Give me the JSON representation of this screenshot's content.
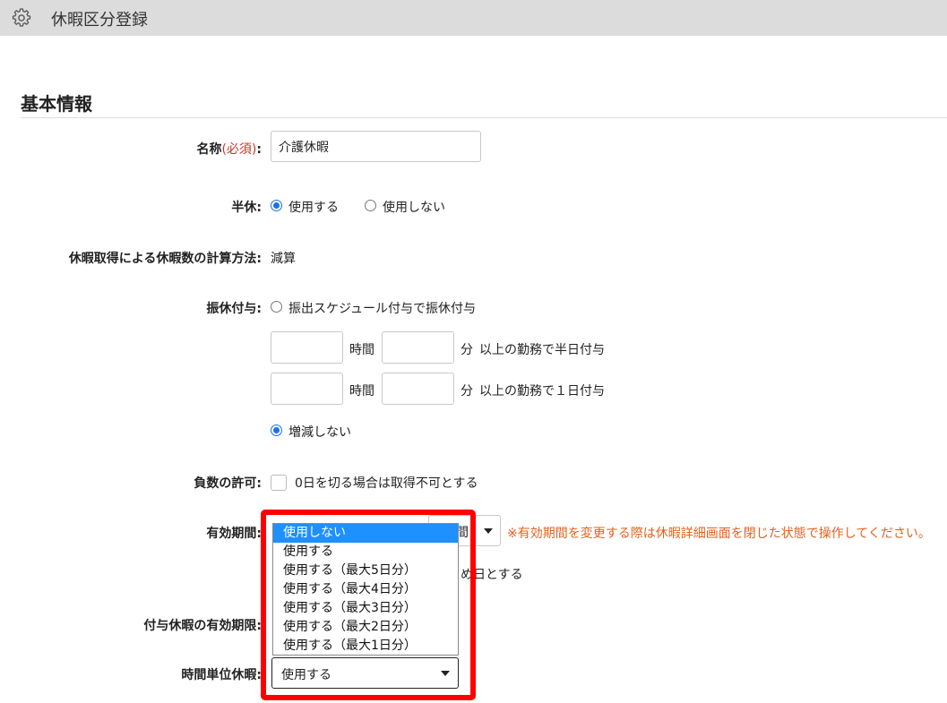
{
  "header": {
    "title": "休暇区分登録",
    "icon": "gear-icon"
  },
  "section": {
    "title": "基本情報"
  },
  "form": {
    "name": {
      "label": "名称",
      "required": "(必須)",
      "colon": ":",
      "value": "介護休暇"
    },
    "half_day": {
      "label": "半休:",
      "options": [
        "使用する",
        "使用しない"
      ],
      "selected": "使用する"
    },
    "calc_method": {
      "label": "休暇取得による休暇数の計算方法:",
      "value": "減算"
    },
    "substitute": {
      "label": "振休付与:",
      "option_schedule": "振出スケジュール付与で振休付与",
      "row_half": {
        "hours_unit": "時間",
        "minutes_unit": "分",
        "suffix": "以上の勤務で半日付与"
      },
      "row_full": {
        "hours_unit": "時間",
        "minutes_unit": "分",
        "suffix": "以上の勤務で１日付与"
      },
      "option_none": "増減しない",
      "selected": "増減しない"
    },
    "negative": {
      "label": "負数の許可:",
      "checkbox_label": "0日を切る場合は取得不可とする"
    },
    "validity": {
      "label": "有効期間:",
      "partial_unit": "間",
      "note": "※有効期間を変更する際は休暇詳細画面を閉じた状態で操作してください。",
      "partial_text": "め日とする"
    },
    "grant_expiry": {
      "label": "付与休暇の有効期限:"
    },
    "hourly_leave": {
      "label": "時間単位休暇:",
      "value": "使用する",
      "dropdown_options": [
        "使用しない",
        "使用する",
        "使用する（最大5日分）",
        "使用する（最大4日分）",
        "使用する（最大3日分）",
        "使用する（最大2日分）",
        "使用する（最大1日分）"
      ],
      "highlighted_option": "使用しない"
    }
  },
  "colors": {
    "accent": "#1a73e8",
    "required": "#c0392b",
    "note": "#e8601c",
    "highlight": "#ff0000",
    "dropdown_selected": "#1e90ff"
  }
}
